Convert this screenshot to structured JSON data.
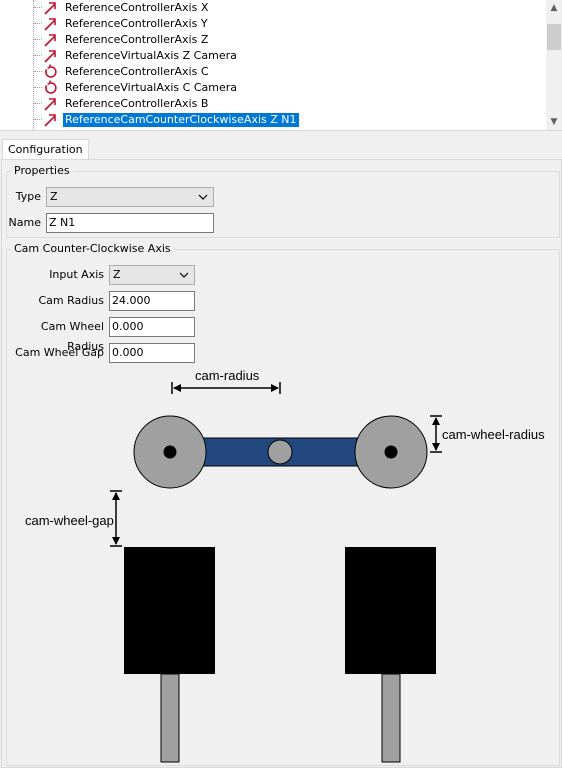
{
  "tree": {
    "items": [
      {
        "label": "ReferenceControllerAxis X",
        "icon": "linear-axis-icon",
        "selected": false
      },
      {
        "label": "ReferenceControllerAxis Y",
        "icon": "linear-axis-icon",
        "selected": false
      },
      {
        "label": "ReferenceControllerAxis Z",
        "icon": "linear-axis-icon",
        "selected": false
      },
      {
        "label": "ReferenceVirtualAxis Z Camera",
        "icon": "linear-axis-icon",
        "selected": false
      },
      {
        "label": "ReferenceControllerAxis C",
        "icon": "rotation-axis-icon",
        "selected": false
      },
      {
        "label": "ReferenceVirtualAxis C Camera",
        "icon": "rotation-axis-icon",
        "selected": false
      },
      {
        "label": "ReferenceControllerAxis B",
        "icon": "linear-axis-icon",
        "selected": false
      },
      {
        "label": "ReferenceCamCounterClockwiseAxis Z N1",
        "icon": "linear-axis-icon",
        "selected": true
      }
    ]
  },
  "tabs": [
    {
      "label": "Configuration"
    }
  ],
  "properties": {
    "title": "Properties",
    "type_label": "Type",
    "type_value": "Z",
    "name_label": "Name",
    "name_value": "Z N1"
  },
  "cam": {
    "title": "Cam Counter-Clockwise Axis",
    "input_axis_label": "Input Axis",
    "input_axis_value": "Z",
    "cam_radius_label": "Cam Radius",
    "cam_radius_value": "24.000",
    "cam_wheel_radius_label": "Cam Wheel Radius",
    "cam_wheel_radius_value": "0.000",
    "cam_wheel_gap_label": "Cam Wheel Gap",
    "cam_wheel_gap_value": "0.000"
  },
  "diagram": {
    "cam_radius": "cam-radius",
    "cam_wheel_radius": "cam-wheel-radius",
    "cam_wheel_gap": "cam-wheel-gap"
  },
  "colors": {
    "linear_icon": "#c8102e",
    "selection": "#0078d7",
    "cam_bar": "#23477f",
    "wheel": "#a0a0a0",
    "motor": "#000000",
    "shaft": "#a0a0a0"
  }
}
